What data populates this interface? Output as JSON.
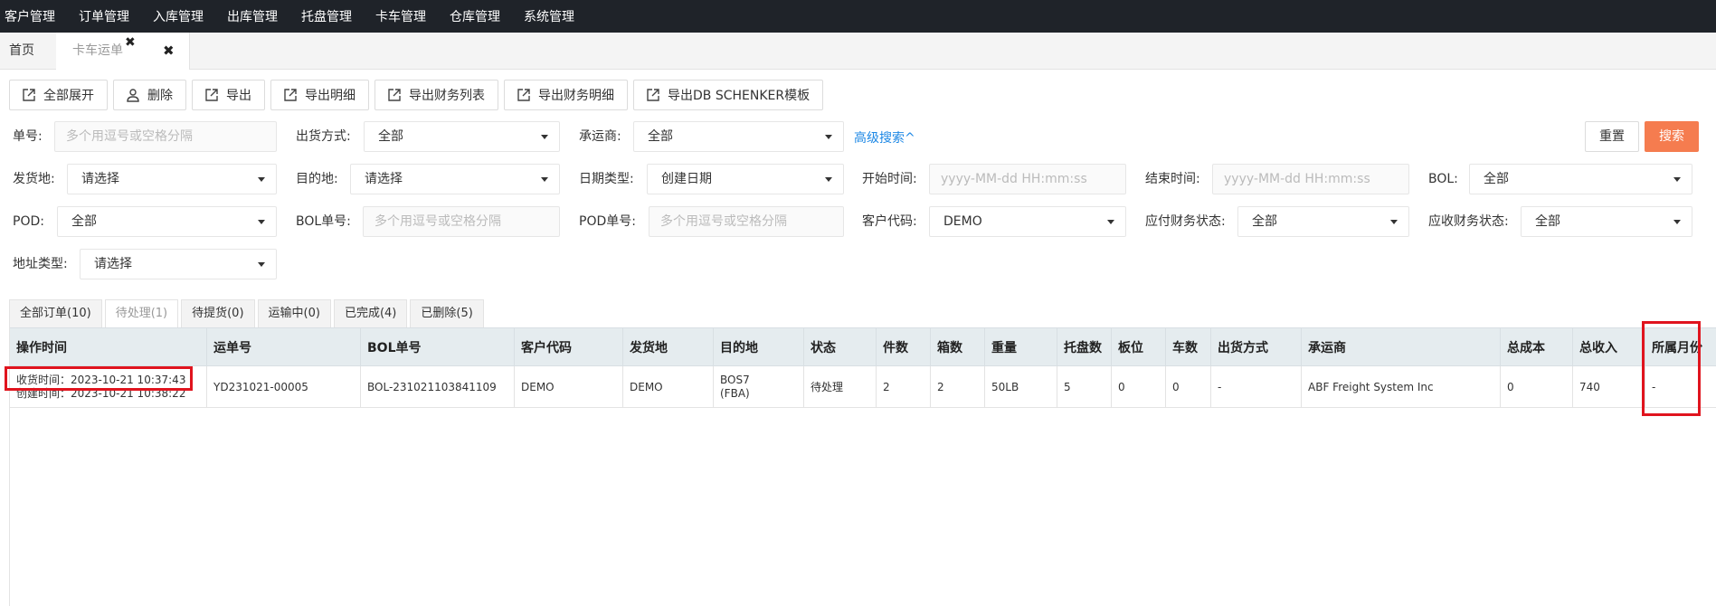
{
  "topnav": [
    "客户管理",
    "订单管理",
    "入库管理",
    "出库管理",
    "托盘管理",
    "卡车管理",
    "仓库管理",
    "系统管理"
  ],
  "tabs": {
    "home": "首页",
    "active": "卡车运单"
  },
  "toolbar": [
    "全部展开",
    "删除",
    "导出",
    "导出明细",
    "导出财务列表",
    "导出财务明细",
    "导出DB SCHENKER模板"
  ],
  "form": {
    "order_no": {
      "label": "单号:",
      "placeholder": "多个用逗号或空格分隔"
    },
    "ship_method": {
      "label": "出货方式:",
      "value": "全部"
    },
    "carrier": {
      "label": "承运商:",
      "value": "全部"
    },
    "advanced": "高级搜索^",
    "reset": "重置",
    "search": "搜索",
    "origin": {
      "label": "发货地:",
      "value": "请选择"
    },
    "destination": {
      "label": "目的地:",
      "value": "请选择"
    },
    "date_type": {
      "label": "日期类型:",
      "value": "创建日期"
    },
    "start_time": {
      "label": "开始时间:",
      "placeholder": "yyyy-MM-dd HH:mm:ss"
    },
    "end_time": {
      "label": "结束时间:",
      "placeholder": "yyyy-MM-dd HH:mm:ss"
    },
    "bol": {
      "label": "BOL:",
      "value": "全部"
    },
    "pod": {
      "label": "POD:",
      "value": "全部"
    },
    "bol_no": {
      "label": "BOL单号:",
      "placeholder": "多个用逗号或空格分隔"
    },
    "pod_no": {
      "label": "POD单号:",
      "placeholder": "多个用逗号或空格分隔"
    },
    "customer_code": {
      "label": "客户代码:",
      "value": "DEMO"
    },
    "payable_status": {
      "label": "应付财务状态:",
      "value": "全部"
    },
    "receivable_status": {
      "label": "应收财务状态:",
      "value": "全部"
    },
    "address_type": {
      "label": "地址类型:",
      "value": "请选择"
    }
  },
  "status_tabs": [
    "全部订单(10)",
    "待处理(1)",
    "待提货(0)",
    "运输中(0)",
    "已完成(4)",
    "已删除(5)"
  ],
  "columns": [
    "操作时间",
    "运单号",
    "BOL单号",
    "客户代码",
    "发货地",
    "目的地",
    "状态",
    "件数",
    "箱数",
    "重量",
    "托盘数",
    "板位",
    "车数",
    "出货方式",
    "承运商",
    "总成本",
    "总收入",
    "所属月份"
  ],
  "row": {
    "time_received": "收货时间：2023-10-21 10:37:43",
    "time_created": "创建时间：2023-10-21 10:38:22",
    "waybill": "YD231021-00005",
    "bol_no": "BOL-231021103841109",
    "customer": "DEMO",
    "origin": "DEMO",
    "dest_line1": "BOS7",
    "dest_line2": "(FBA)",
    "status": "待处理",
    "pieces": "2",
    "cartons": "2",
    "weight": "50LB",
    "pallets": "5",
    "positions": "0",
    "trucks": "0",
    "ship_method": "-",
    "carrier": "ABF Freight System Inc",
    "total_cost": "0",
    "total_income": "740",
    "month": "-"
  }
}
